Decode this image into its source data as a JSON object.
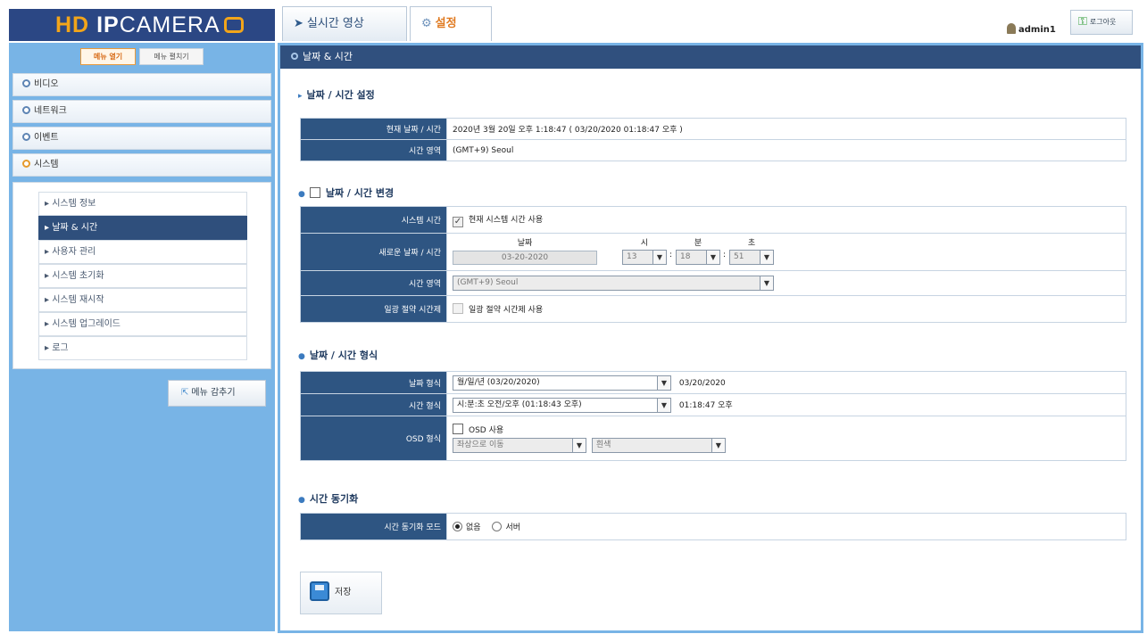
{
  "header": {
    "logo_hd": "HD ",
    "logo_ip": "IP",
    "logo_camera": "CAMERA",
    "tabs": [
      {
        "label": "실시간 영상",
        "icon": "camera-icon"
      },
      {
        "label": "설정",
        "icon": "gears-icon"
      }
    ],
    "username": "admin1",
    "logout_label": "로그아웃"
  },
  "sidebar": {
    "menu_open_label": "메뉴 열기",
    "menu_close_label": "메뉴 펼치기",
    "items": [
      "비디오",
      "네트워크",
      "이벤트",
      "시스템"
    ],
    "sub_items": [
      "시스템 정보",
      "날짜 & 시간",
      "사용자 관리",
      "시스템 초기화",
      "시스템 재시작",
      "시스템 업그레이드",
      "로그"
    ],
    "hide_menu_label": "메뉴 감추기"
  },
  "main": {
    "title": "날짜 & 시간",
    "settings_section": "날짜 / 시간 설정",
    "current_label": "현재 날짜 / 시간",
    "current_value": "2020년 3월 20일 오후 1:18:47  ( 03/20/2020  01:18:47 오후 )",
    "zone_label": "시간 영역",
    "zone_value": "(GMT+9) Seoul",
    "change_section": "날짜 / 시간 변경",
    "system_time_label": "시스템 시간",
    "use_system_time": "현재 시스템 시간 사용",
    "new_datetime_label": "새로운 날짜 / 시간",
    "date_caption": "날짜",
    "date_value": "03-20-2020",
    "hour_caption": "시",
    "hour_value": "13",
    "minute_caption": "분",
    "minute_value": "18",
    "second_caption": "초",
    "second_value": "51",
    "zone2_label": "시간 영역",
    "zone2_value": "(GMT+9) Seoul",
    "dst_label": "일광 절약 시간제",
    "dst_option": "일광 절약 시간제 사용",
    "format_section": "날짜 / 시간 형식",
    "date_format_label": "날짜 형식",
    "date_format_value": "월/일/년 (03/20/2020)",
    "date_format_preview": "03/20/2020",
    "time_format_label": "시간 형식",
    "time_format_value": "시:분:초 오전/오후 (01:18:43 오후)",
    "time_format_preview": "01:18:47 오후",
    "osd_label": "OSD 형식",
    "osd_use": "OSD 사용",
    "osd_position": "좌상으로 이동",
    "osd_color": "흰색",
    "sync_section": "시간 동기화",
    "sync_mode_label": "시간 동기화 모드",
    "sync_none": "없음",
    "sync_server": "서버",
    "save_label": "저장"
  }
}
